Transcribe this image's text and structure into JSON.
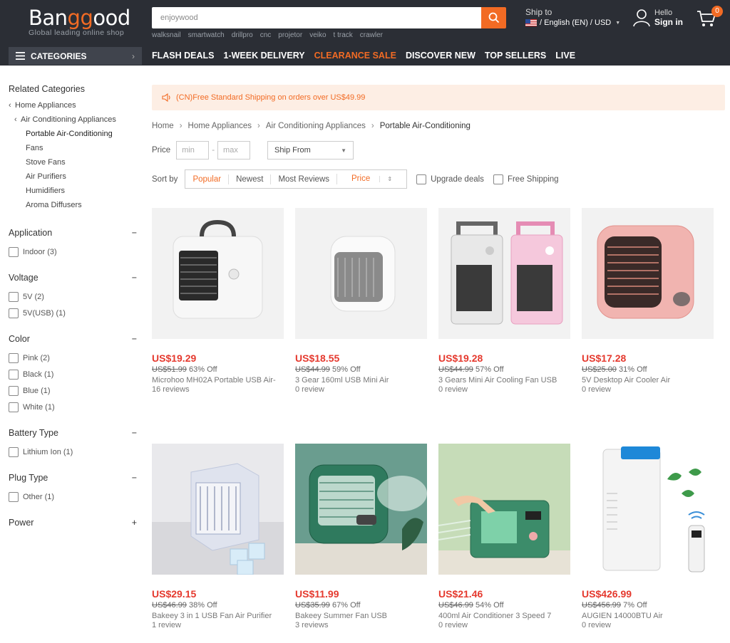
{
  "header": {
    "logo_main_a": "Ban",
    "logo_main_b": "gg",
    "logo_main_c": "ood",
    "logo_tagline": "Global leading online shop",
    "search_value": "enjoywood",
    "hot_words": [
      "walksnail",
      "smartwatch",
      "drillpro",
      "cnc",
      "projetor",
      "veiko",
      "t track",
      "crawler"
    ],
    "ship_to_label": "Ship to",
    "ship_to_value": "/ English (EN) / USD",
    "hello": "Hello",
    "sign_in": "Sign in",
    "cart_count": "0"
  },
  "nav": {
    "categories_label": "CATEGORIES",
    "links": [
      "FLASH DEALS",
      "1-WEEK DELIVERY",
      "CLEARANCE SALE",
      "DISCOVER NEW",
      "TOP SELLERS",
      "LIVE"
    ]
  },
  "sidebar": {
    "related_title": "Related Categories",
    "categories": [
      {
        "label": "Home Appliances"
      },
      {
        "label": "Air Conditioning Appliances"
      },
      {
        "label": "Portable Air-Conditioning"
      },
      {
        "label": "Fans"
      },
      {
        "label": "Stove Fans"
      },
      {
        "label": "Air Purifiers"
      },
      {
        "label": "Humidifiers"
      },
      {
        "label": "Aroma Diffusers"
      }
    ],
    "facets": [
      {
        "title": "Application",
        "toggle": "−",
        "options": [
          "Indoor (3)"
        ]
      },
      {
        "title": "Voltage",
        "toggle": "−",
        "options": [
          "5V (2)",
          "5V(USB) (1)"
        ]
      },
      {
        "title": "Color",
        "toggle": "−",
        "options": [
          "Pink (2)",
          "Black (1)",
          "Blue (1)",
          "White (1)"
        ]
      },
      {
        "title": "Battery Type",
        "toggle": "−",
        "options": [
          "Lithium Ion (1)"
        ]
      },
      {
        "title": "Plug Type",
        "toggle": "−",
        "options": [
          "Other (1)"
        ]
      },
      {
        "title": "Power",
        "toggle": "+",
        "options": []
      }
    ]
  },
  "main": {
    "notice": "(CN)Free Standard Shipping on orders over US$49.99",
    "breadcrumb": [
      "Home",
      "Home Appliances",
      "Air Conditioning Appliances",
      "Portable Air-Conditioning"
    ],
    "price_label": "Price",
    "price_min_placeholder": "min",
    "price_max_placeholder": "max",
    "ship_from": "Ship From",
    "sort_label": "Sort by",
    "sort_options": [
      "Popular",
      "Newest",
      "Most Reviews",
      "Price"
    ],
    "upgrade_deals": "Upgrade deals",
    "free_shipping": "Free Shipping"
  },
  "products": [
    {
      "price": "US$19.29",
      "old": "US$51.99",
      "off": "63% Off",
      "name": "Microhoo MH02A Portable USB Air-",
      "reviews": "16 reviews"
    },
    {
      "price": "US$18.55",
      "old": "US$44.99",
      "off": "59% Off",
      "name": "3 Gear 160ml USB Mini Air",
      "reviews": "0 review"
    },
    {
      "price": "US$19.28",
      "old": "US$44.99",
      "off": "57% Off",
      "name": "3 Gears Mini Air Cooling Fan USB",
      "reviews": "0 review"
    },
    {
      "price": "US$17.28",
      "old": "US$25.00",
      "off": "31% Off",
      "name": "5V Desktop Air Cooler Air",
      "reviews": "0 review"
    },
    {
      "price": "US$29.15",
      "old": "US$46.99",
      "off": "38% Off",
      "name": "Bakeey 3 in 1 USB Fan Air Purifier",
      "reviews": "1 review"
    },
    {
      "price": "US$11.99",
      "old": "US$35.99",
      "off": "67% Off",
      "name": "Bakeey Summer Fan USB",
      "reviews": "3 reviews"
    },
    {
      "price": "US$21.46",
      "old": "US$46.99",
      "off": "54% Off",
      "name": "400ml Air Conditioner 3 Speed 7",
      "reviews": "0 review"
    },
    {
      "price": "US$426.99",
      "old": "US$456.99",
      "off": "7% Off",
      "name": "AUGIEN 14000BTU Air",
      "reviews": "0 review"
    }
  ],
  "colors": {
    "brand_orange": "#f26b24",
    "price_red": "#e5392e",
    "header_bg": "#2b2e35"
  }
}
